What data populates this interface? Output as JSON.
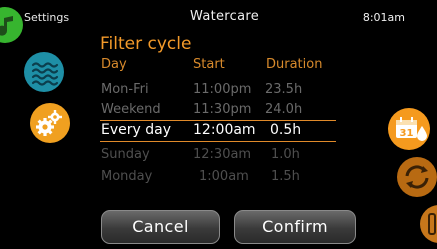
{
  "topbar": {
    "left_label": "Settings",
    "title": "Watercare",
    "time": "8:01am"
  },
  "heading": "Filter cycle",
  "columns": {
    "day": "Day",
    "start": "Start",
    "duration": "Duration"
  },
  "rows": [
    {
      "day": "Mon-Fri",
      "start": "11:00pm",
      "duration": "23.5h"
    },
    {
      "day": "Weekend",
      "start": "11:30pm",
      "duration": "24.0h"
    },
    {
      "day": "Every day",
      "start": "12:00am",
      "duration": "0.5h"
    },
    {
      "day": "Sunday",
      "start": "12:30am",
      "duration": "1.0h"
    },
    {
      "day": "Monday",
      "start": "1:00am",
      "duration": "1.5h"
    }
  ],
  "selected_row_index": 2,
  "buttons": {
    "cancel": "Cancel",
    "confirm": "Confirm"
  },
  "calendar_icon_day": "31",
  "icons": [
    "music-icon",
    "water-waves-icon",
    "gear-icon",
    "calendar-drop-icon",
    "recycle-refresh-icon",
    "side-device-icon"
  ],
  "colors": {
    "accent": "#f39a2a",
    "teal": "#1e8fa6",
    "green": "#3bbf2f"
  }
}
